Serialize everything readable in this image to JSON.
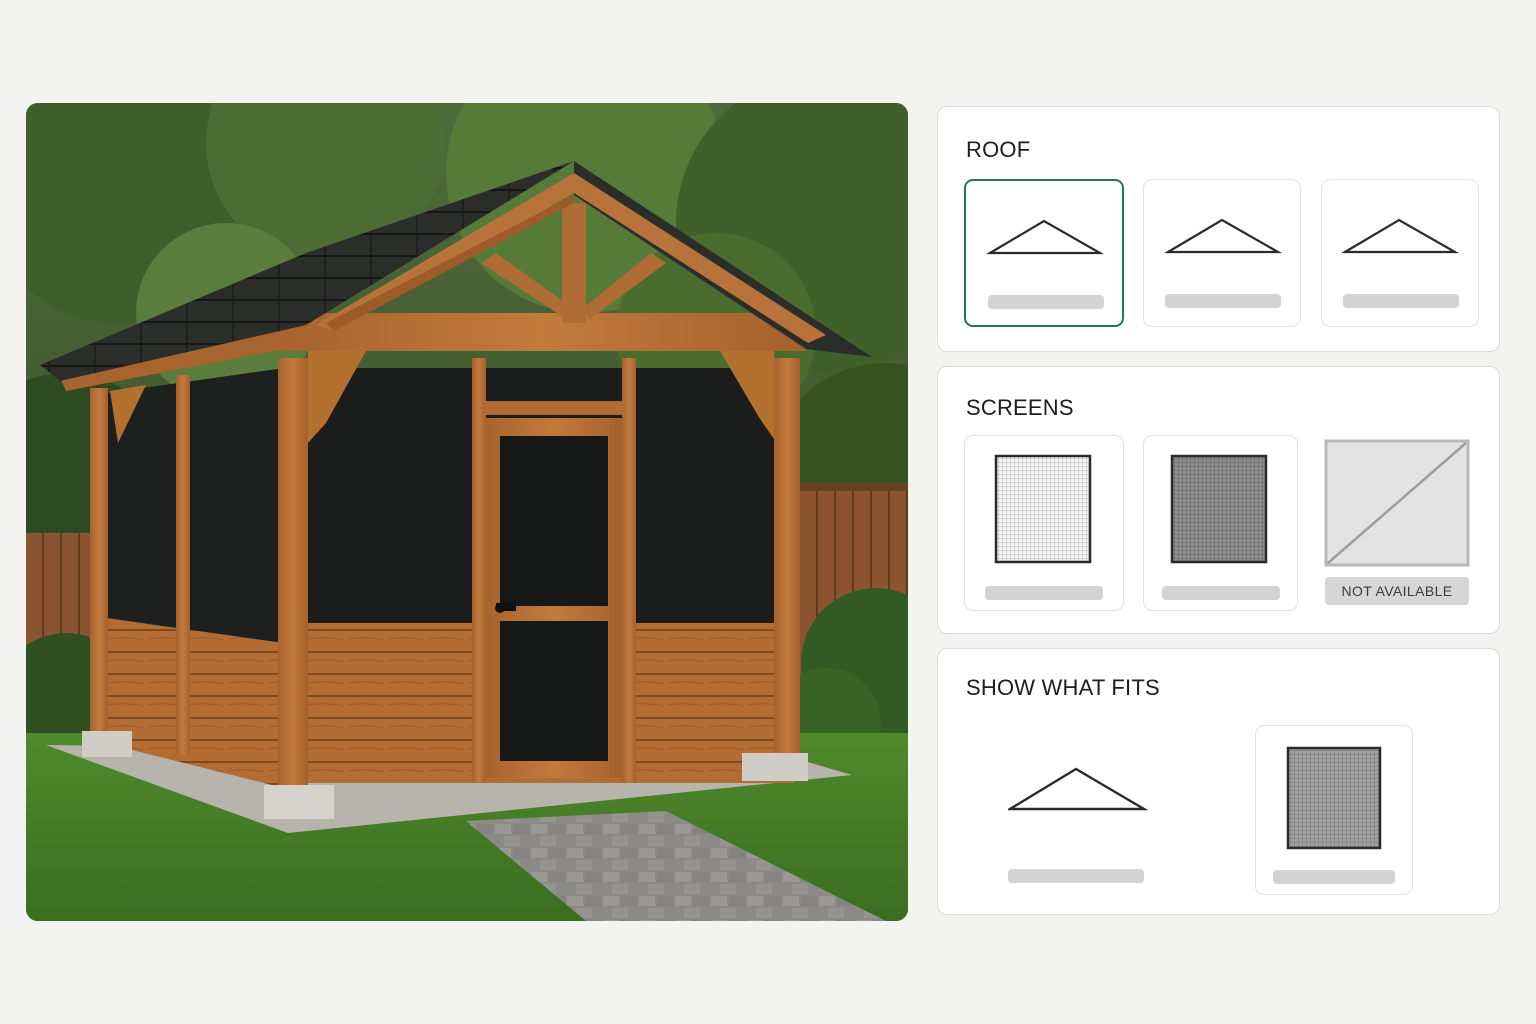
{
  "colors": {
    "background": "#f3f3f1",
    "selected_border": "#1f7a4f",
    "card_border": "#e2e2e2",
    "placeholder_bar": "#d3d3d3"
  },
  "photo": {
    "subject": "screened wooden gazebo in backyard"
  },
  "roof": {
    "title": "ROOF",
    "options": [
      {
        "icon": "roof-gable-icon",
        "selected": true
      },
      {
        "icon": "roof-gable-icon",
        "selected": false
      },
      {
        "icon": "roof-gable-icon",
        "selected": false
      }
    ]
  },
  "screens": {
    "title": "SCREENS",
    "options": [
      {
        "icon": "light-mesh-screen-icon",
        "available": true
      },
      {
        "icon": "dark-mesh-screen-icon",
        "available": true
      },
      {
        "icon": "no-screen-icon",
        "available": false,
        "badge": "NOT AVAILABLE"
      }
    ]
  },
  "fits": {
    "title": "SHOW WHAT FITS",
    "items": [
      {
        "icon": "roof-gable-icon"
      },
      {
        "icon": "mesh-screen-icon"
      }
    ]
  }
}
